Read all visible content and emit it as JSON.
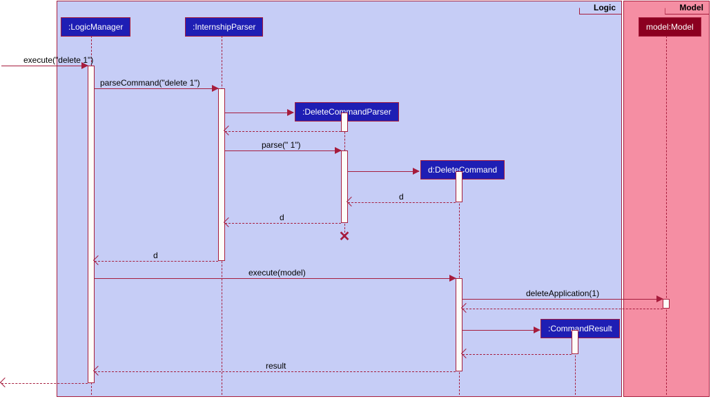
{
  "frames": {
    "logic": "Logic",
    "model": "Model"
  },
  "participants": {
    "logicManager": ":LogicManager",
    "internshipParser": ":InternshipParser",
    "deleteCommandParser": ":DeleteCommandParser",
    "deleteCommand": "d:DeleteCommand",
    "commandResult": ":CommandResult",
    "modelObj": "model:Model"
  },
  "messages": {
    "execute": "execute(\"delete 1\")",
    "parseCommand": "parseCommand(\"delete 1\")",
    "parse": "parse(\" 1\")",
    "returnD1": "d",
    "returnD2": "d",
    "returnD3": "d",
    "executeModel": "execute(model)",
    "deleteApp": "deleteApplication(1)",
    "result": "result"
  },
  "chart_data": {
    "type": "sequence_diagram",
    "frames": [
      {
        "name": "Logic",
        "participants": [
          "LogicManager",
          "InternshipParser",
          "DeleteCommandParser",
          "DeleteCommand",
          "CommandResult"
        ]
      },
      {
        "name": "Model",
        "participants": [
          "model:Model"
        ]
      }
    ],
    "participants": [
      {
        "id": "LogicManager",
        "label": ":LogicManager",
        "created_at_start": true
      },
      {
        "id": "InternshipParser",
        "label": ":InternshipParser",
        "created_at_start": true
      },
      {
        "id": "DeleteCommandParser",
        "label": ":DeleteCommandParser",
        "created_at_start": false,
        "destroyed": true
      },
      {
        "id": "DeleteCommand",
        "label": "d:DeleteCommand",
        "created_at_start": false
      },
      {
        "id": "CommandResult",
        "label": ":CommandResult",
        "created_at_start": false
      },
      {
        "id": "Model",
        "label": "model:Model",
        "created_at_start": true
      }
    ],
    "messages": [
      {
        "from": "external",
        "to": "LogicManager",
        "label": "execute(\"delete 1\")",
        "type": "sync"
      },
      {
        "from": "LogicManager",
        "to": "InternshipParser",
        "label": "parseCommand(\"delete 1\")",
        "type": "sync"
      },
      {
        "from": "InternshipParser",
        "to": "DeleteCommandParser",
        "label": "",
        "type": "create"
      },
      {
        "from": "DeleteCommandParser",
        "to": "InternshipParser",
        "label": "",
        "type": "return"
      },
      {
        "from": "InternshipParser",
        "to": "DeleteCommandParser",
        "label": "parse(\" 1\")",
        "type": "sync"
      },
      {
        "from": "DeleteCommandParser",
        "to": "DeleteCommand",
        "label": "",
        "type": "create"
      },
      {
        "from": "DeleteCommand",
        "to": "DeleteCommandParser",
        "label": "d",
        "type": "return"
      },
      {
        "from": "DeleteCommandParser",
        "to": "InternshipParser",
        "label": "d",
        "type": "return"
      },
      {
        "from": "DeleteCommandParser",
        "to": "DeleteCommandParser",
        "label": "",
        "type": "destroy"
      },
      {
        "from": "InternshipParser",
        "to": "LogicManager",
        "label": "d",
        "type": "return"
      },
      {
        "from": "LogicManager",
        "to": "DeleteCommand",
        "label": "execute(model)",
        "type": "sync"
      },
      {
        "from": "DeleteCommand",
        "to": "Model",
        "label": "deleteApplication(1)",
        "type": "sync"
      },
      {
        "from": "Model",
        "to": "DeleteCommand",
        "label": "",
        "type": "return"
      },
      {
        "from": "DeleteCommand",
        "to": "CommandResult",
        "label": "",
        "type": "create"
      },
      {
        "from": "CommandResult",
        "to": "DeleteCommand",
        "label": "",
        "type": "return"
      },
      {
        "from": "DeleteCommand",
        "to": "LogicManager",
        "label": "result",
        "type": "return"
      },
      {
        "from": "LogicManager",
        "to": "external",
        "label": "",
        "type": "return"
      }
    ]
  }
}
